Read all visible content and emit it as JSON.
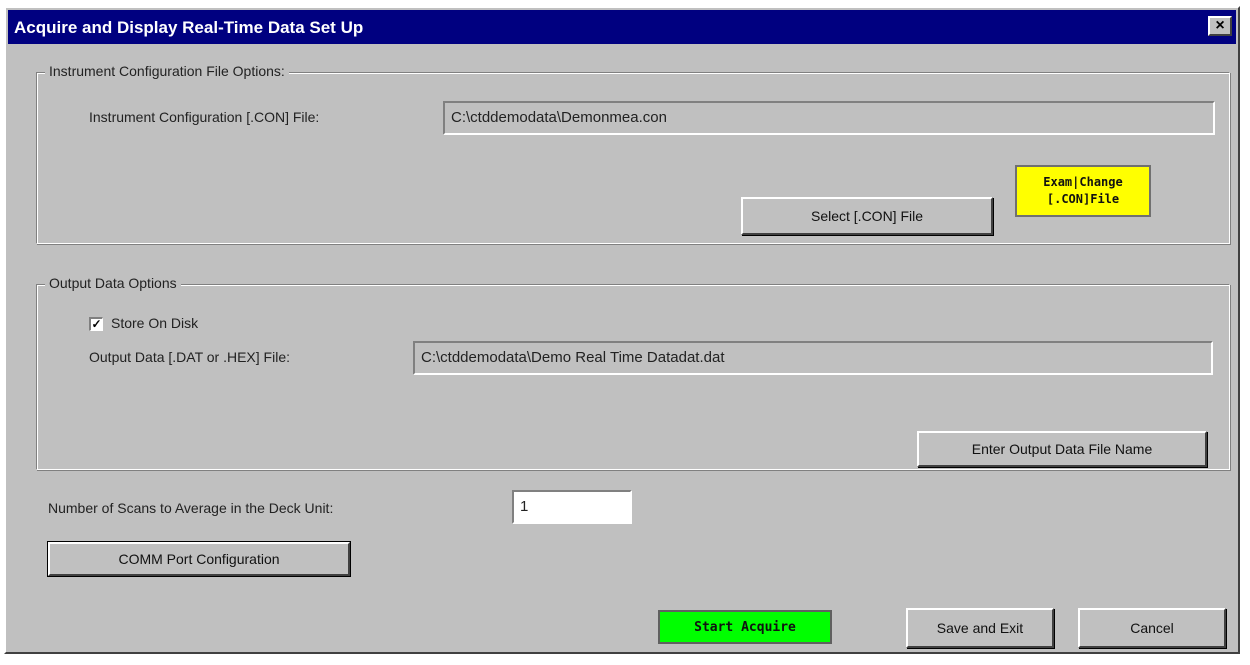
{
  "window": {
    "title": "Acquire and Display Real-Time Data Set Up",
    "close_glyph": "×"
  },
  "instrument_group": {
    "legend": "Instrument Configuration File Options:",
    "con_label": "Instrument Configuration [.CON] File:",
    "con_value": "C:\\ctddemodata\\Demonmea.con",
    "select_button": "Select [.CON] File",
    "exam_line1": "Exam|Change",
    "exam_line2": "[.CON]File"
  },
  "output_group": {
    "legend": "Output Data Options",
    "store_label": "Store On Disk",
    "store_checked": "✓",
    "dat_label": "Output Data [.DAT or .HEX] File:",
    "dat_value": "C:\\ctddemodata\\Demo Real Time Datadat.dat",
    "enter_button": "Enter Output Data File Name"
  },
  "scans": {
    "label": "Number of Scans to Average in the Deck Unit:",
    "value": "1"
  },
  "buttons": {
    "comm": "COMM Port Configuration",
    "start": "Start Acquire",
    "save_exit": "Save and Exit",
    "cancel": "Cancel"
  }
}
